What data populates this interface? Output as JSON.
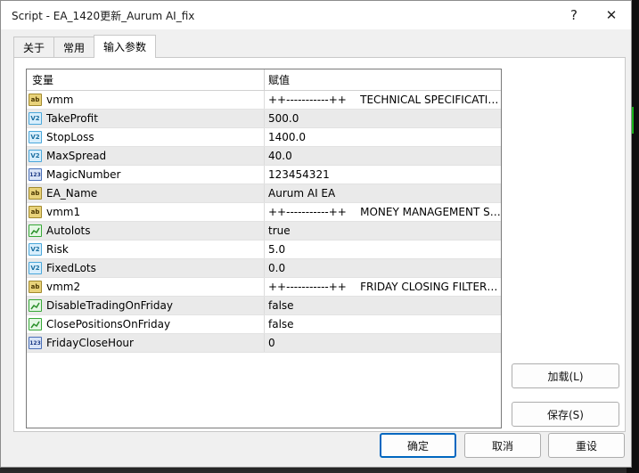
{
  "window": {
    "title": "Script - EA_1420更新_Aurum AI_fix",
    "help_glyph": "?",
    "close_glyph": "✕"
  },
  "tabs": [
    {
      "label": "关于",
      "active": false
    },
    {
      "label": "常用",
      "active": false
    },
    {
      "label": "输入参数",
      "active": true
    }
  ],
  "grid": {
    "header": {
      "variable": "变量",
      "value": "赋值"
    },
    "rows": [
      {
        "icon": "ab",
        "name": "vmm",
        "value": "++-----------++    TECHNICAL SPECIFICATIONS"
      },
      {
        "icon": "v2",
        "name": "TakeProfit",
        "value": "500.0"
      },
      {
        "icon": "v2",
        "name": "StopLoss",
        "value": "1400.0"
      },
      {
        "icon": "v2",
        "name": "MaxSpread",
        "value": "40.0"
      },
      {
        "icon": "123",
        "name": "MagicNumber",
        "value": "123454321"
      },
      {
        "icon": "ab",
        "name": "EA_Name",
        "value": "Aurum AI EA"
      },
      {
        "icon": "ab",
        "name": "vmm1",
        "value": "++-----------++    MONEY MANAGEMENT SETTINGS"
      },
      {
        "icon": "bool",
        "name": "Autolots",
        "value": "true"
      },
      {
        "icon": "v2",
        "name": "Risk",
        "value": "5.0"
      },
      {
        "icon": "v2",
        "name": "FixedLots",
        "value": "0.0"
      },
      {
        "icon": "ab",
        "name": "vmm2",
        "value": "++-----------++    FRIDAY CLOSING FILTER SETTINGS"
      },
      {
        "icon": "bool",
        "name": "DisableTradingOnFriday",
        "value": "false"
      },
      {
        "icon": "bool",
        "name": "ClosePositionsOnFriday",
        "value": "false"
      },
      {
        "icon": "123",
        "name": "FridayCloseHour",
        "value": "0"
      }
    ]
  },
  "buttons": {
    "load": "加载(L)",
    "save": "保存(S)",
    "ok": "确定",
    "cancel": "取消",
    "reset": "重设"
  },
  "colors": {
    "accent": "#0067c0",
    "chart_green": "#1ed31e"
  }
}
